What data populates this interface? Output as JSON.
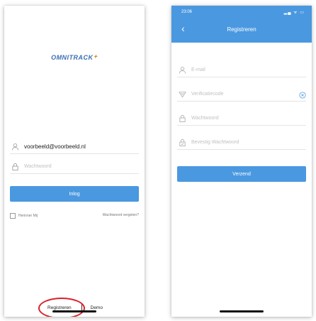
{
  "login": {
    "logo": "OMNITRACK",
    "email_value": "voorbeeld@voorbeeld.nl",
    "password_placeholder": "Wachtwoord",
    "login_button": "Inlog",
    "remember_me": "Herinner Mij",
    "forgot_password": "Wachtwoord vergeten?",
    "register_link": "Registreren",
    "demo_link": "Demo"
  },
  "register": {
    "status_time": "23:06",
    "status_icons": "▂▄ ᯤ ▭",
    "title": "Registreren",
    "email_placeholder": "E-mail",
    "code_placeholder": "Verificatiecode",
    "password_placeholder": "Wachtwoord",
    "confirm_placeholder": "Bevestig Wachtwoord",
    "submit_button": "Verzend"
  },
  "colors": {
    "accent": "#4a98e0",
    "highlight_circle": "#d9202b"
  }
}
